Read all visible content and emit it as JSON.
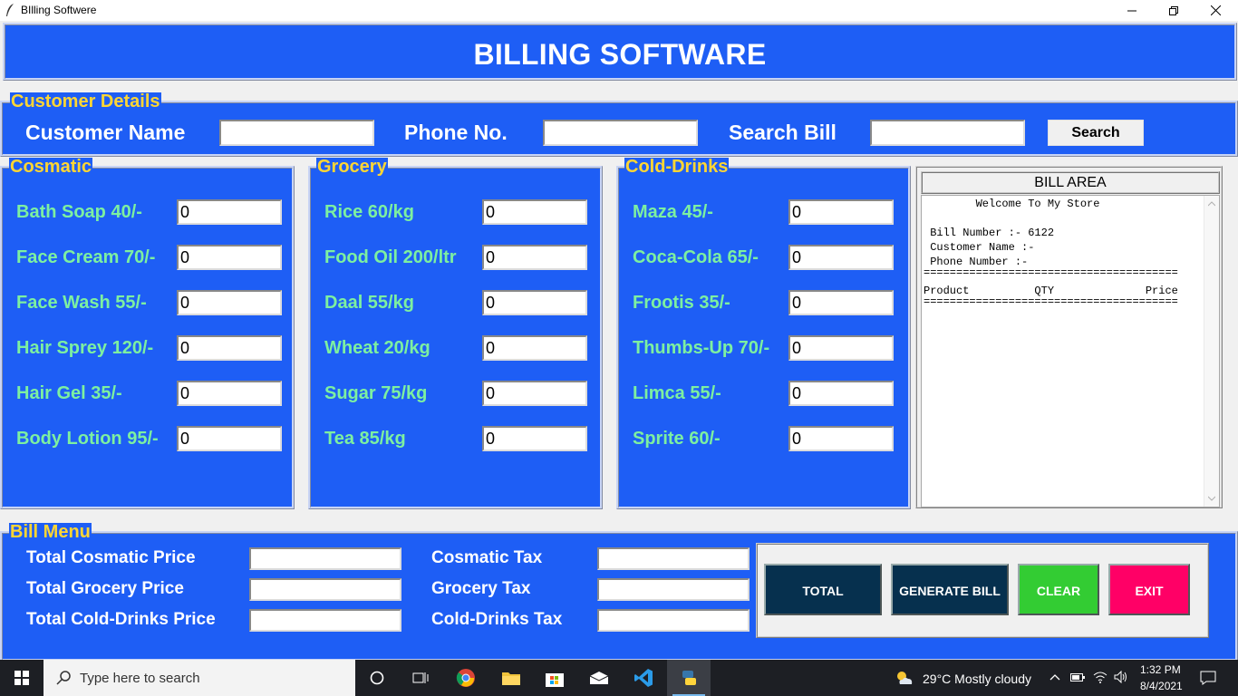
{
  "window": {
    "title": "BIlling Softwere"
  },
  "header": {
    "title": "BILLING SOFTWARE"
  },
  "customer": {
    "legend": "Customer Details",
    "name_label": "Customer Name",
    "phone_label": "Phone No.",
    "search_label": "Search Bill",
    "name_value": "",
    "phone_value": "",
    "search_value": "",
    "search_button": "Search"
  },
  "cosmetic": {
    "legend": "Cosmatic",
    "items": [
      {
        "label": "Bath Soap 40/-",
        "value": "0"
      },
      {
        "label": "Face Cream 70/-",
        "value": "0"
      },
      {
        "label": "Face Wash 55/-",
        "value": "0"
      },
      {
        "label": "Hair Sprey 120/-",
        "value": "0"
      },
      {
        "label": "Hair Gel 35/-",
        "value": "0"
      },
      {
        "label": "Body Lotion 95/-",
        "value": "0"
      }
    ]
  },
  "grocery": {
    "legend": "Grocery",
    "items": [
      {
        "label": "Rice 60/kg",
        "value": "0"
      },
      {
        "label": "Food Oil 200/ltr",
        "value": "0"
      },
      {
        "label": "Daal 55/kg",
        "value": "0"
      },
      {
        "label": "Wheat 20/kg",
        "value": "0"
      },
      {
        "label": "Sugar 75/kg",
        "value": "0"
      },
      {
        "label": "Tea 85/kg",
        "value": "0"
      }
    ]
  },
  "drinks": {
    "legend": "Cold-Drinks",
    "items": [
      {
        "label": "Maza 45/-",
        "value": "0"
      },
      {
        "label": "Coca-Cola 65/-",
        "value": "0"
      },
      {
        "label": "Frootis 35/-",
        "value": "0"
      },
      {
        "label": "Thumbs-Up 70/-",
        "value": "0"
      },
      {
        "label": "Limca 55/-",
        "value": "0"
      },
      {
        "label": "Sprite 60/-",
        "value": "0"
      }
    ]
  },
  "bill_area": {
    "title": "BILL AREA",
    "lines": [
      "        Welcome To My Store",
      "",
      " Bill Number :- 6122",
      " Customer Name :-",
      " Phone Number :-",
      "=======================================",
      "Product          QTY              Price",
      "======================================="
    ]
  },
  "bill_menu": {
    "legend": "Bill Menu",
    "total_cosmetic_label": "Total Cosmatic Price",
    "total_grocery_label": "Total Grocery Price",
    "total_drinks_label": "Total Cold-Drinks Price",
    "cosmetic_tax_label": "Cosmatic Tax",
    "grocery_tax_label": "Grocery Tax",
    "drinks_tax_label": "Cold-Drinks Tax"
  },
  "buttons": {
    "total": "TOTAL",
    "generate": "GENERATE BILL",
    "clear": "CLEAR",
    "exit": "EXIT"
  },
  "taskbar": {
    "search_placeholder": "Type here to search",
    "weather": "29°C  Mostly cloudy",
    "time": "1:32 PM",
    "date": "8/4/2021"
  },
  "colors": {
    "panel_blue": "#1e5ef5",
    "legend_yellow": "#ffd633",
    "item_green": "#7df0a0",
    "total_button": "#06304e",
    "clear_button": "#33cc33",
    "exit_button": "#ff0066"
  }
}
